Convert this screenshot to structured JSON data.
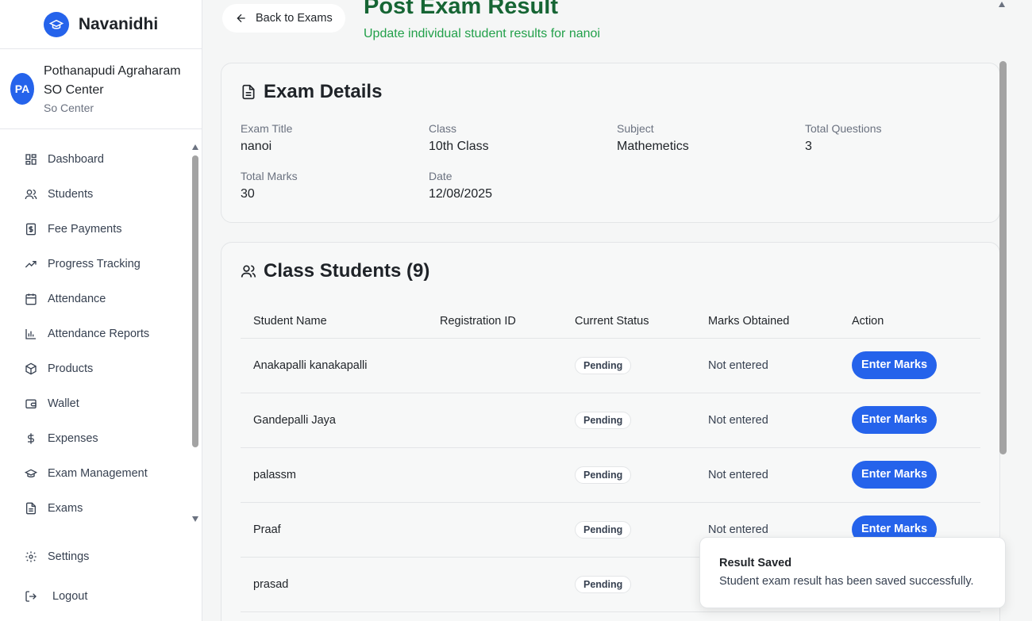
{
  "brand": {
    "name": "Navanidhi"
  },
  "center": {
    "initials": "PA",
    "name": "Pothanapudi Agraharam SO Center",
    "role": "So Center"
  },
  "sidebar": {
    "items": [
      {
        "label": "Dashboard",
        "icon": "dashboard-icon"
      },
      {
        "label": "Students",
        "icon": "users-icon"
      },
      {
        "label": "Fee Payments",
        "icon": "receipt-icon"
      },
      {
        "label": "Progress Tracking",
        "icon": "trending-up-icon"
      },
      {
        "label": "Attendance",
        "icon": "calendar-icon"
      },
      {
        "label": "Attendance Reports",
        "icon": "bar-chart-icon"
      },
      {
        "label": "Products",
        "icon": "package-icon"
      },
      {
        "label": "Wallet",
        "icon": "wallet-icon"
      },
      {
        "label": "Expenses",
        "icon": "dollar-icon"
      },
      {
        "label": "Exam Management",
        "icon": "graduation-cap-icon"
      },
      {
        "label": "Exams",
        "icon": "file-text-icon"
      }
    ],
    "settings": "Settings",
    "logout": "Logout"
  },
  "header": {
    "back_label": "Back to Exams",
    "title": "Post Exam Result",
    "subtitle": "Update individual student results for nanoi"
  },
  "exam_details": {
    "heading": "Exam Details",
    "fields": [
      {
        "label": "Exam Title",
        "value": "nanoi"
      },
      {
        "label": "Class",
        "value": "10th Class"
      },
      {
        "label": "Subject",
        "value": "Mathemetics"
      },
      {
        "label": "Total Questions",
        "value": "3"
      },
      {
        "label": "Total Marks",
        "value": "30"
      },
      {
        "label": "Date",
        "value": "12/08/2025"
      }
    ]
  },
  "students": {
    "heading": "Class Students (9)",
    "columns": [
      "Student Name",
      "Registration ID",
      "Current Status",
      "Marks Obtained",
      "Action"
    ],
    "rows": [
      {
        "name": "Anakapalli kanakapalli",
        "reg_id": "",
        "status": "Pending",
        "marks": "Not entered",
        "action": "Enter Marks"
      },
      {
        "name": "Gandepalli Jaya",
        "reg_id": "",
        "status": "Pending",
        "marks": "Not entered",
        "action": "Enter Marks"
      },
      {
        "name": "palassm",
        "reg_id": "",
        "status": "Pending",
        "marks": "Not entered",
        "action": "Enter Marks"
      },
      {
        "name": "Praaf",
        "reg_id": "",
        "status": "Pending",
        "marks": "Not entered",
        "action": "Enter Marks"
      },
      {
        "name": "prasad",
        "reg_id": "",
        "status": "Pending",
        "marks": "",
        "action": ""
      }
    ]
  },
  "toast": {
    "title": "Result Saved",
    "description": "Student exam result has been saved successfully."
  },
  "colors": {
    "primary": "#2563eb",
    "title_green": "#166534",
    "subtitle_green": "#22a04a"
  }
}
